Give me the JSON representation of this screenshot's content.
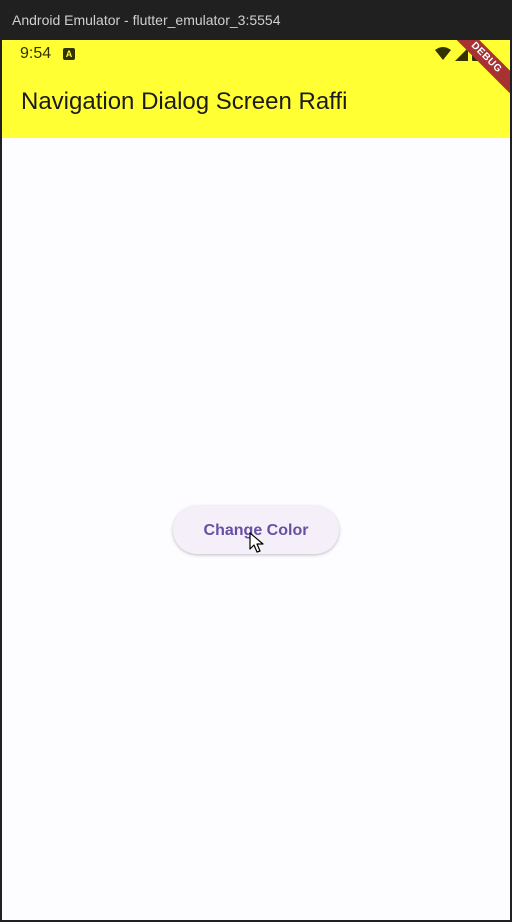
{
  "window": {
    "title": "Android Emulator - flutter_emulator_3:5554"
  },
  "statusbar": {
    "time": "9:54",
    "notification_icon": "A",
    "icons": [
      "wifi-icon",
      "signal-icon",
      "battery-icon"
    ]
  },
  "appbar": {
    "title": "Navigation Dialog Screen Raffi",
    "background_color": "#ffff33"
  },
  "debug_banner": {
    "label": "DEBUG"
  },
  "main": {
    "button_label": "Change Color",
    "button_text_color": "#6750a4"
  }
}
